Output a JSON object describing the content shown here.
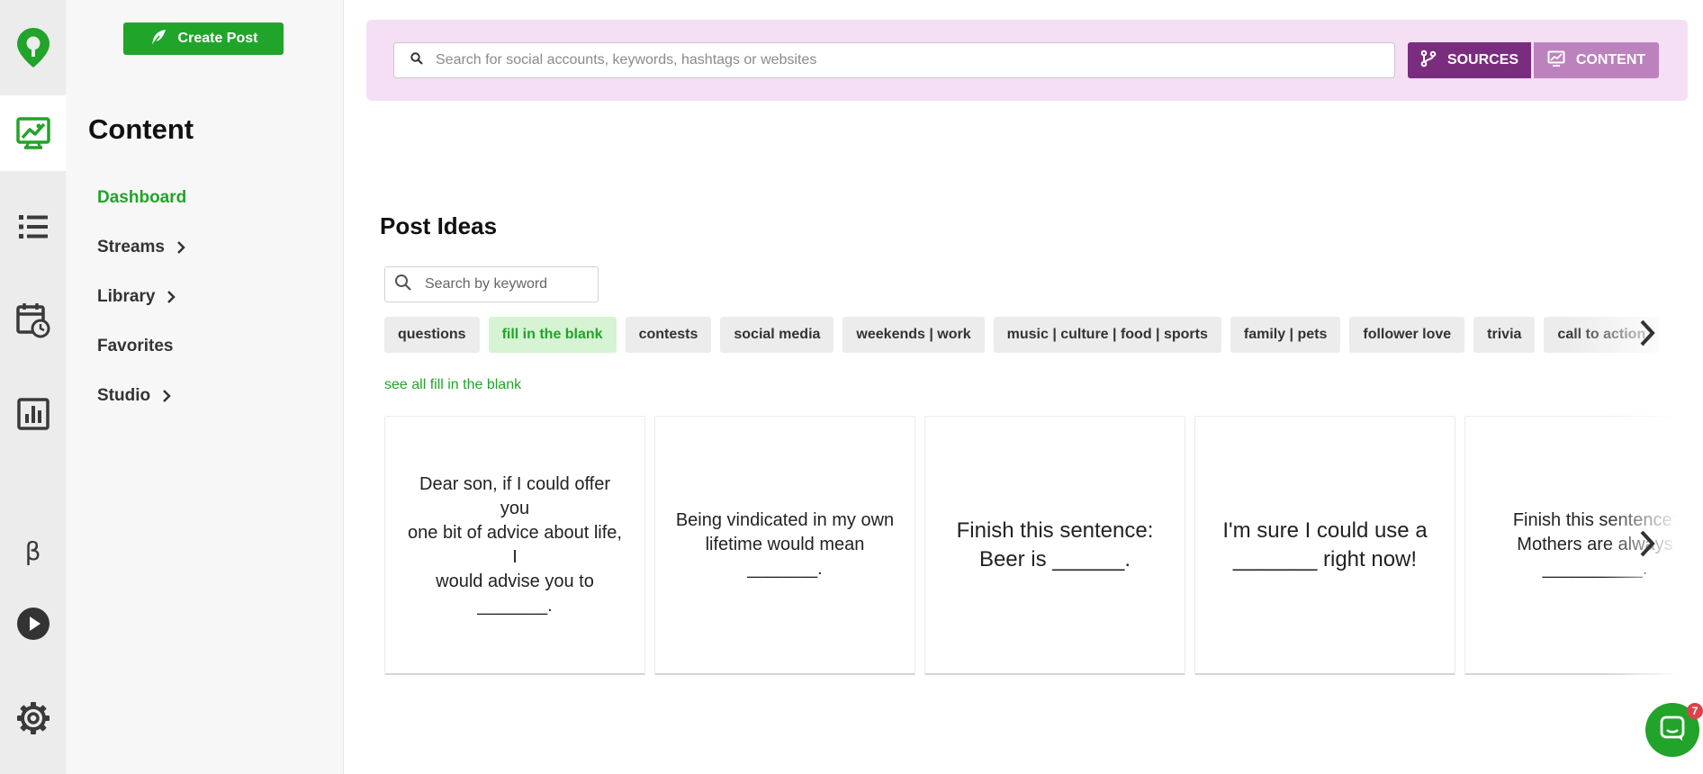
{
  "brand": {
    "accent": "#22a32a",
    "purple_dark": "#7a2d7f",
    "purple_light": "#bb82bd",
    "banner_bg": "#f5dff5"
  },
  "rail": {
    "items": [
      {
        "icon": "location-pin-logo-icon"
      },
      {
        "icon": "content-image-icon",
        "active": true
      },
      {
        "icon": "list-icon"
      },
      {
        "icon": "calendar-clock-icon"
      },
      {
        "icon": "bar-chart-icon"
      },
      {
        "icon": "beta-icon",
        "label": "β"
      },
      {
        "icon": "play-circle-icon"
      },
      {
        "icon": "gear-icon"
      }
    ]
  },
  "sidebar": {
    "create_post_label": "Create Post",
    "title": "Content",
    "nav": [
      {
        "label": "Dashboard",
        "active": true,
        "has_chevron": false
      },
      {
        "label": "Streams",
        "active": false,
        "has_chevron": true
      },
      {
        "label": "Library",
        "active": false,
        "has_chevron": true
      },
      {
        "label": "Favorites",
        "active": false,
        "has_chevron": false
      },
      {
        "label": "Studio",
        "active": false,
        "has_chevron": true
      }
    ]
  },
  "search": {
    "placeholder": "Search for social accounts, keywords, hashtags or websites",
    "sources_label": "SOURCES",
    "content_label": "CONTENT"
  },
  "post_ideas": {
    "title": "Post Ideas",
    "keyword_placeholder": "Search by keyword",
    "categories": [
      {
        "label": "questions",
        "active": false
      },
      {
        "label": "fill in the blank",
        "active": true
      },
      {
        "label": "contests",
        "active": false
      },
      {
        "label": "social media",
        "active": false
      },
      {
        "label": "weekends | work",
        "active": false
      },
      {
        "label": "music | culture | food | sports",
        "active": false
      },
      {
        "label": "family | pets",
        "active": false
      },
      {
        "label": "follower love",
        "active": false
      },
      {
        "label": "trivia",
        "active": false
      },
      {
        "label": "call to action",
        "active": false
      }
    ],
    "see_all_label": "see all fill in the blank",
    "cards": [
      {
        "lines": [
          "Dear son, if I could offer you",
          "one bit of advice about life, I",
          "would advise you to",
          "_______."
        ],
        "size": "s"
      },
      {
        "lines": [
          "Being vindicated in my own",
          "lifetime would mean",
          "_______."
        ],
        "size": "s"
      },
      {
        "lines": [
          "Finish this sentence:",
          "Beer is ______."
        ],
        "size": "l"
      },
      {
        "lines": [
          "I'm sure I could use a",
          "_______ right now!"
        ],
        "size": "l"
      },
      {
        "lines": [
          "Finish this sentence:",
          "Mothers are always",
          "__________."
        ],
        "size": "s"
      }
    ]
  },
  "chat": {
    "badge_count": "7"
  }
}
